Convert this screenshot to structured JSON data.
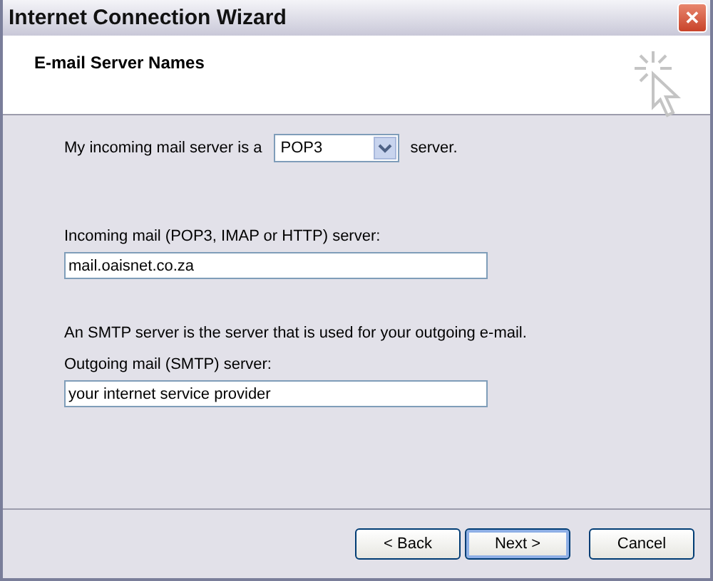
{
  "window": {
    "title": "Internet Connection Wizard",
    "close": "✕"
  },
  "header": {
    "title": "E-mail Server Names"
  },
  "server_type": {
    "prefix": "My incoming mail server is a",
    "value": "POP3",
    "suffix": "server."
  },
  "incoming": {
    "label": "Incoming mail (POP3, IMAP or HTTP) server:",
    "value": "mail.oaisnet.co.za"
  },
  "smtp_note": "An SMTP server is the server that is used for your outgoing e-mail.",
  "outgoing": {
    "label": "Outgoing mail (SMTP) server:",
    "value": "your internet service provider"
  },
  "buttons": [
    {
      "label": "< Back",
      "default": false
    },
    {
      "label": "Next >",
      "default": true
    },
    {
      "label": "Cancel",
      "default": false
    }
  ]
}
